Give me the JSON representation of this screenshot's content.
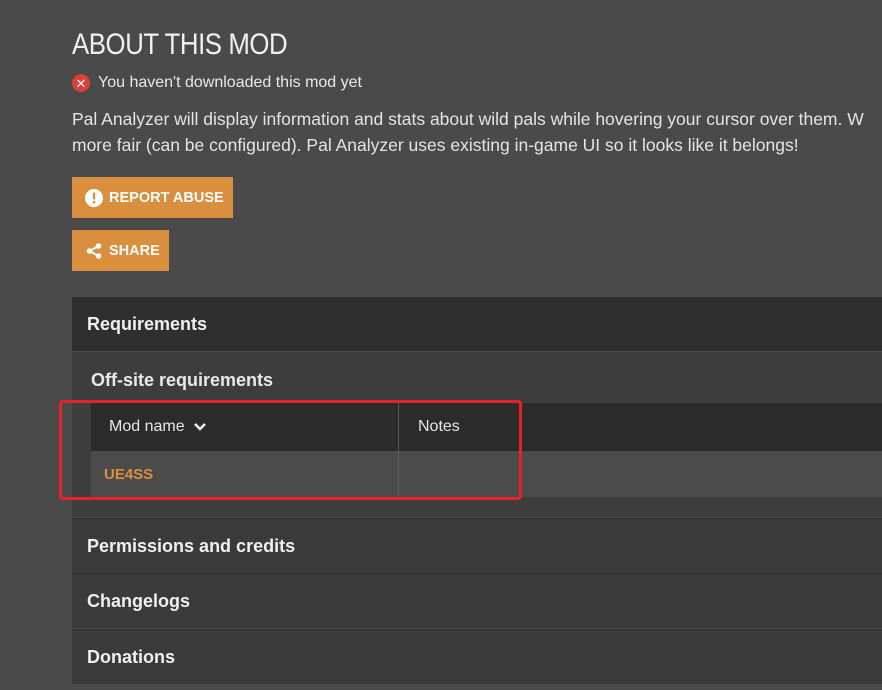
{
  "about": {
    "title": "ABOUT THIS MOD",
    "status_text": "You haven't downloaded this mod yet",
    "description_line1": "Pal Analyzer will display information and stats about wild pals while hovering your cursor over them. W",
    "description_line2": "more fair (can be configured). Pal Analyzer uses existing in-game UI so it looks like it belongs!"
  },
  "buttons": {
    "report_abuse": "REPORT ABUSE",
    "share": "SHARE"
  },
  "requirements": {
    "header": "Requirements",
    "offsite_title": "Off-site requirements",
    "columns": {
      "mod_name": "Mod name",
      "notes": "Notes"
    },
    "rows": [
      {
        "mod_name": "UE4SS",
        "notes": ""
      }
    ]
  },
  "sections": {
    "permissions": "Permissions and credits",
    "changelogs": "Changelogs",
    "donations": "Donations"
  },
  "colors": {
    "accent": "#d98f3d",
    "error": "#d9403a",
    "highlight": "#e8202a",
    "background": "#4a4a4a"
  },
  "icons": {
    "status": "close-circle-icon",
    "report": "exclamation-circle-icon",
    "share": "share-icon",
    "sort": "chevron-down-icon"
  }
}
